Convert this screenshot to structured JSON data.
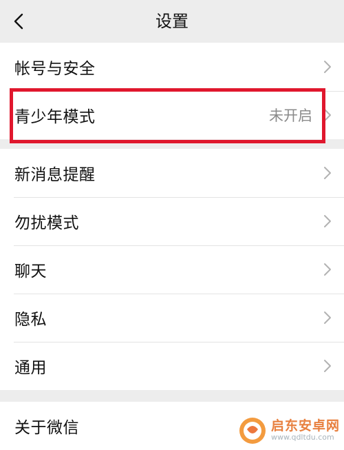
{
  "header": {
    "title": "设置",
    "back_icon": "chevron-left-icon"
  },
  "groups": [
    {
      "items": [
        {
          "label": "帐号与安全",
          "value": ""
        }
      ]
    },
    {
      "items": [
        {
          "label": "青少年模式",
          "value": "未开启"
        }
      ]
    },
    {
      "items": [
        {
          "label": "新消息提醒",
          "value": ""
        },
        {
          "label": "勿扰模式",
          "value": ""
        },
        {
          "label": "聊天",
          "value": ""
        },
        {
          "label": "隐私",
          "value": ""
        },
        {
          "label": "通用",
          "value": ""
        }
      ]
    },
    {
      "items": [
        {
          "label": "关于微信",
          "value": ""
        }
      ]
    }
  ],
  "annotation": {
    "highlight_color": "#e0172d"
  },
  "watermark": {
    "main": "启东安卓网",
    "sub": "www.qdltdu.com"
  },
  "colors": {
    "background": "#ededed",
    "row_bg": "#ffffff",
    "value_text": "#8a8a8a",
    "chevron": "#b2b2b2"
  }
}
